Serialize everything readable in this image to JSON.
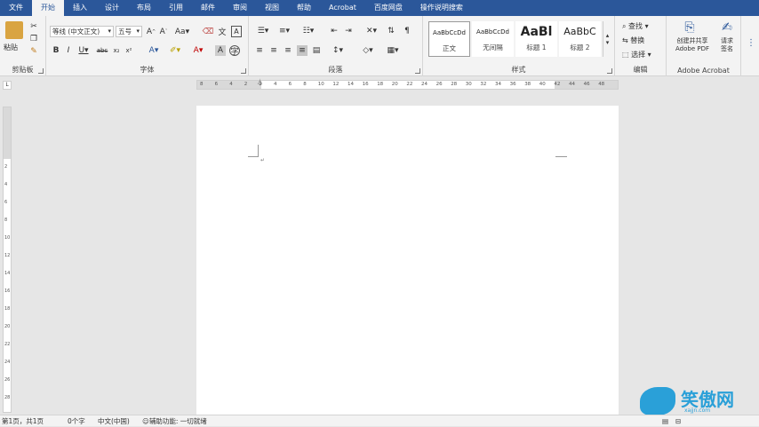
{
  "tabs": [
    "文件",
    "开始",
    "插入",
    "设计",
    "布局",
    "引用",
    "邮件",
    "审阅",
    "视图",
    "帮助",
    "Acrobat",
    "百度网盘",
    "操作说明搜索"
  ],
  "active_tab": "开始",
  "clipboard": {
    "paste_label": "粘贴",
    "group_label": "剪贴板"
  },
  "font": {
    "name": "等线 (中文正文)",
    "size": "五号",
    "group_label": "字体"
  },
  "paragraph": {
    "group_label": "段落"
  },
  "styles": {
    "group_label": "样式",
    "items": [
      {
        "sample": "AaBbCcDd",
        "name": "正文"
      },
      {
        "sample": "AaBbCcDd",
        "name": "无间隔"
      },
      {
        "sample": "AaBl",
        "name": "标题 1"
      },
      {
        "sample": "AaBbC",
        "name": "标题 2"
      }
    ]
  },
  "editing": {
    "find": "查找",
    "replace": "替换",
    "select": "选择",
    "group_label": "编辑"
  },
  "acrobat": {
    "create_pdf": "创建并共享\nAdobe PDF",
    "request_sign": "请求\n签名",
    "group_label": "Adobe Acrobat"
  },
  "ruler": {
    "ticks": [
      "8",
      "6",
      "4",
      "2",
      "2",
      "4",
      "6",
      "8",
      "10",
      "12",
      "14",
      "16",
      "18",
      "20",
      "22",
      "24",
      "26",
      "28",
      "30",
      "32",
      "34",
      "36",
      "38",
      "40",
      "42",
      "44",
      "46",
      "48"
    ]
  },
  "vruler": {
    "ticks": [
      "2",
      "4",
      "6",
      "8",
      "10",
      "12",
      "14",
      "16",
      "18",
      "20",
      "22",
      "24",
      "26",
      "28"
    ]
  },
  "status": {
    "page": "第1页，共1页",
    "words": "0个字",
    "lang": "中文(中国)",
    "accessibility": "辅助功能: 一切就绪"
  },
  "watermark": {
    "text": "笑傲网",
    "url": "xajjn.com"
  },
  "colors": {
    "accent": "#2b579a",
    "ribbon": "#f3f3f3",
    "canvas": "#e6e6e6"
  }
}
